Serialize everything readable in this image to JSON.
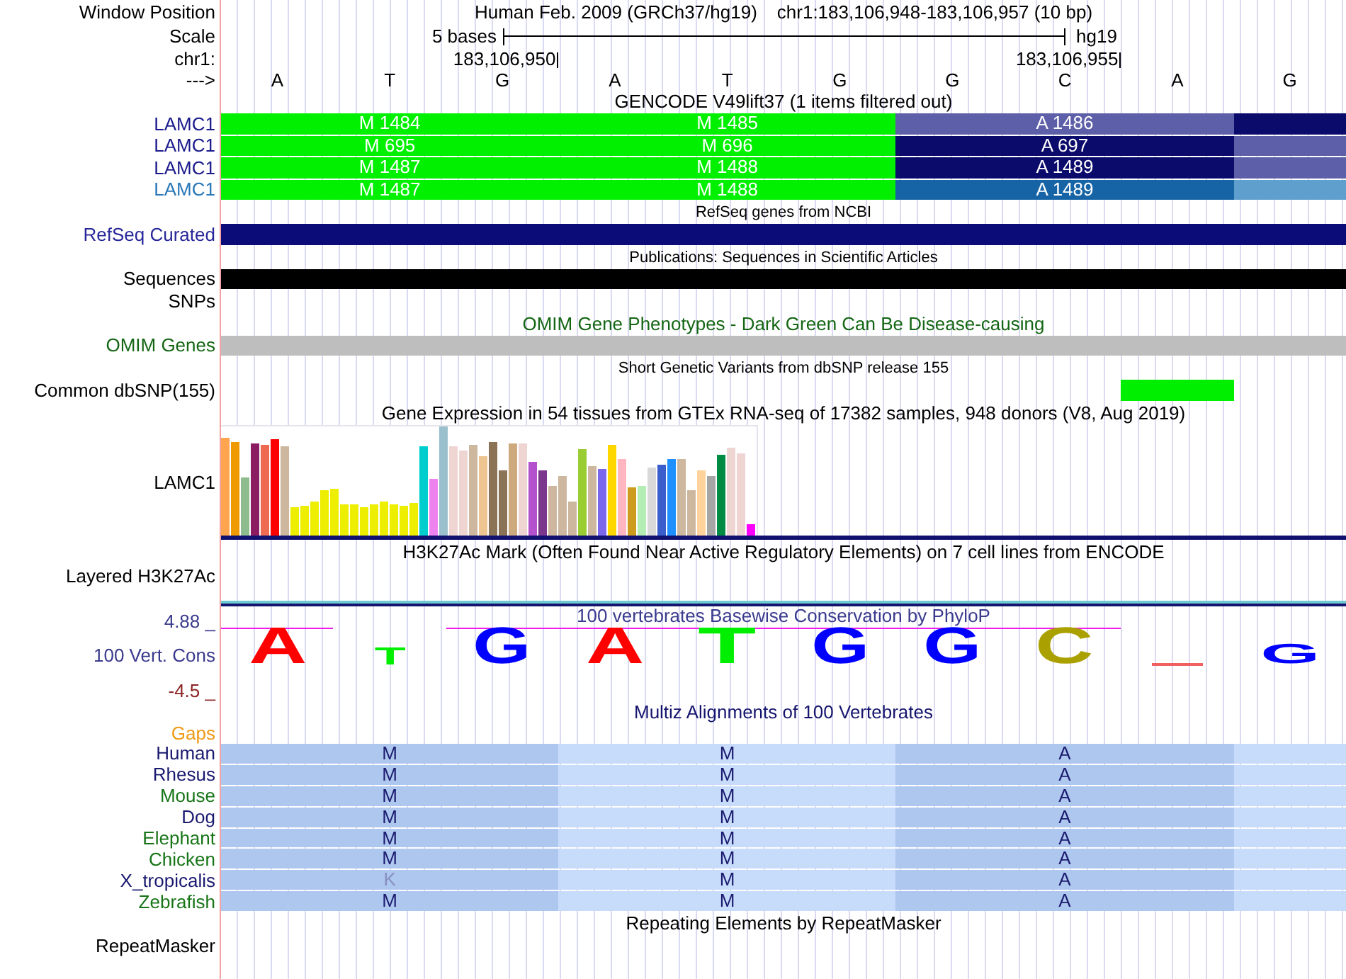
{
  "window_position": {
    "label": "Window Position",
    "assembly": "Human Feb. 2009 (GRCh37/hg19)",
    "range": "chr1:183,106,948-183,106,957 (10 bp)"
  },
  "scale": {
    "label": "Scale",
    "length": "5 bases",
    "assembly": "hg19"
  },
  "ruler": {
    "label": "chr1:",
    "positions": [
      {
        "tick": false
      },
      {
        "tick": false
      },
      {
        "tick": true,
        "label": "183,106,950"
      },
      {
        "tick": false
      },
      {
        "tick": false
      },
      {
        "tick": false
      },
      {
        "tick": false
      },
      {
        "tick": true,
        "label": "183,106,955"
      },
      {
        "tick": false
      },
      {
        "tick": false
      }
    ]
  },
  "sequence": {
    "label": "--->",
    "bases": [
      "A",
      "T",
      "G",
      "A",
      "T",
      "G",
      "G",
      "C",
      "A",
      "G"
    ]
  },
  "tracks": [
    {
      "kind": "features",
      "title": {
        "text": "GENCODE V49lift37 (1 items filtered out)",
        "color": "#000000"
      },
      "rows": [
        {
          "label": "LAMC1",
          "color": "#1b1b8c",
          "segments": [
            {
              "kind": "codon",
              "text": "M 1484",
              "color": "#00f000"
            },
            {
              "kind": "codon",
              "text": "M 1485",
              "color": "#00f000"
            },
            {
              "kind": "codon",
              "text": "A 1486",
              "color": "#5d5fa8"
            },
            {
              "kind": "base",
              "color": "#0b0b6c"
            }
          ]
        },
        {
          "label": "LAMC1",
          "color": "#1b1b8c",
          "segments": [
            {
              "kind": "codon",
              "text": "M 695",
              "color": "#00f000"
            },
            {
              "kind": "codon",
              "text": "M 696",
              "color": "#00f000"
            },
            {
              "kind": "codon",
              "text": "A 697",
              "color": "#0b0b6c"
            },
            {
              "kind": "base",
              "color": "#5d5fa8"
            }
          ]
        },
        {
          "label": "LAMC1",
          "color": "#1b1b8c",
          "segments": [
            {
              "kind": "codon",
              "text": "M 1487",
              "color": "#00f000"
            },
            {
              "kind": "codon",
              "text": "M 1488",
              "color": "#00f000"
            },
            {
              "kind": "codon",
              "text": "A 1489",
              "color": "#0b0b6c"
            },
            {
              "kind": "base",
              "color": "#5d5fa8"
            }
          ]
        },
        {
          "label": "LAMC1",
          "color": "#2a78b8",
          "segments": [
            {
              "kind": "codon",
              "text": "M 1487",
              "color": "#00f000"
            },
            {
              "kind": "codon",
              "text": "M 1488",
              "color": "#00f000"
            },
            {
              "kind": "codon",
              "text": "A 1489",
              "color": "#1664a6"
            },
            {
              "kind": "base",
              "color": "#5f9fcd"
            }
          ]
        }
      ]
    },
    {
      "kind": "features",
      "title": {
        "text": "RefSeq genes from NCBI",
        "color": "#000000"
      },
      "rows": [
        {
          "label": "RefSeq Curated",
          "color": "#27279a",
          "segments": [
            {
              "kind": "full",
              "color": "#0c0c78"
            }
          ]
        }
      ]
    },
    {
      "kind": "features",
      "title": {
        "text": "Publications: Sequences in Scientific Articles",
        "color": "#000000"
      },
      "rows": [
        {
          "label": "Sequences",
          "color": "#000000",
          "segments": [
            {
              "kind": "full",
              "color": "#000000"
            }
          ]
        },
        {
          "label": "SNPs",
          "color": "#000000"
        }
      ]
    },
    {
      "kind": "features",
      "title": {
        "text": "OMIM Gene Phenotypes - Dark Green Can Be Disease-causing",
        "color": "#146614"
      },
      "rows": [
        {
          "label": "OMIM Genes",
          "color": "#146614",
          "segments": [
            {
              "kind": "full",
              "color": "#bebebe"
            }
          ]
        }
      ]
    },
    {
      "kind": "features",
      "title": {
        "text": "Short Genetic Variants from dbSNP release 155",
        "color": "#000000"
      },
      "rows": [
        {
          "label": "Common dbSNP(155)",
          "color": "#000000",
          "segments": [
            {
              "kind": "empty"
            },
            {
              "kind": "empty"
            },
            {
              "kind": "empty"
            },
            {
              "kind": "empty"
            },
            {
              "kind": "empty"
            },
            {
              "kind": "empty"
            },
            {
              "kind": "empty"
            },
            {
              "kind": "empty"
            },
            {
              "kind": "base",
              "color": "#00ee00"
            },
            {
              "kind": "empty"
            }
          ]
        }
      ]
    },
    {
      "kind": "expression",
      "title": {
        "text": "Gene Expression in 54 tissues from GTEx RNA-seq of 17382 samples, 948 donors (V8, Aug 2019)",
        "color": "#000000"
      },
      "rows": [
        {
          "label": "LAMC1",
          "color": "#000000"
        }
      ]
    },
    {
      "kind": "signal",
      "title": {
        "text": "H3K27Ac Mark (Often Found Near Active Regulatory Elements) on 7 cell lines from ENCODE",
        "color": "#000000"
      },
      "rows": [
        {
          "label": "Layered H3K27Ac",
          "color": "#000000"
        }
      ]
    },
    {
      "kind": "conservation",
      "title": {
        "text": "100 vertebrates Basewise Conservation by PhyloP",
        "color": "#3a3a8e"
      },
      "label": {
        "text": "100 Vert. Cons",
        "color": "#3a3a8e"
      },
      "max_label": {
        "text": "4.88 _",
        "color": "#3a3a8e"
      },
      "min_label": {
        "text": "-4.5 _",
        "color": "#8b2323"
      },
      "logo": [
        {
          "kind": "letter",
          "text": "A",
          "color": "#ff0000",
          "clipped": true
        },
        {
          "kind": "letter",
          "text": "T",
          "color": "#00ee00",
          "clipped": false
        },
        {
          "kind": "letter",
          "text": "G",
          "color": "#0000ff",
          "clipped": true
        },
        {
          "kind": "letter",
          "text": "A",
          "color": "#ff0000",
          "clipped": true
        },
        {
          "kind": "letter",
          "text": "T",
          "color": "#00ee00",
          "clipped": true
        },
        {
          "kind": "letter",
          "text": "G",
          "color": "#0000ff",
          "clipped": true
        },
        {
          "kind": "letter",
          "text": "G",
          "color": "#0000ff",
          "clipped": true
        },
        {
          "kind": "letter",
          "text": "C",
          "color": "#aaa000",
          "clipped": true
        },
        {
          "kind": "mark",
          "color": "#f06060",
          "clipped": false
        },
        {
          "kind": "letter",
          "text": "G",
          "color": "#0000ff",
          "clipped": false
        }
      ]
    },
    {
      "kind": "alignment",
      "title": {
        "text": "Multiz Alignments of 100 Vertebrates",
        "color": "#15156e"
      },
      "gaps": {
        "text": "Gaps",
        "color": "#ee9a16"
      },
      "rows": [
        {
          "label": "Human",
          "color": "#191970",
          "cells": [
            {
              "kind": "codon",
              "text": "M",
              "mismatch": false
            },
            {
              "kind": "codon",
              "text": "M",
              "mismatch": false
            },
            {
              "kind": "codon",
              "text": "A",
              "mismatch": false
            },
            {
              "kind": "base"
            }
          ]
        },
        {
          "label": "Rhesus",
          "color": "#191970",
          "cells": [
            {
              "kind": "codon",
              "text": "M",
              "mismatch": false
            },
            {
              "kind": "codon",
              "text": "M",
              "mismatch": false
            },
            {
              "kind": "codon",
              "text": "A",
              "mismatch": false
            },
            {
              "kind": "base"
            }
          ]
        },
        {
          "label": "Mouse",
          "color": "#177517",
          "cells": [
            {
              "kind": "codon",
              "text": "M",
              "mismatch": false
            },
            {
              "kind": "codon",
              "text": "M",
              "mismatch": false
            },
            {
              "kind": "codon",
              "text": "A",
              "mismatch": false
            },
            {
              "kind": "base"
            }
          ]
        },
        {
          "label": "Dog",
          "color": "#191970",
          "cells": [
            {
              "kind": "codon",
              "text": "M",
              "mismatch": false
            },
            {
              "kind": "codon",
              "text": "M",
              "mismatch": false
            },
            {
              "kind": "codon",
              "text": "A",
              "mismatch": false
            },
            {
              "kind": "base"
            }
          ]
        },
        {
          "label": "Elephant",
          "color": "#177517",
          "cells": [
            {
              "kind": "codon",
              "text": "M",
              "mismatch": false
            },
            {
              "kind": "codon",
              "text": "M",
              "mismatch": false
            },
            {
              "kind": "codon",
              "text": "A",
              "mismatch": false
            },
            {
              "kind": "base"
            }
          ]
        },
        {
          "label": "Chicken",
          "color": "#177517",
          "cells": [
            {
              "kind": "codon",
              "text": "M",
              "mismatch": false
            },
            {
              "kind": "codon",
              "text": "M",
              "mismatch": false
            },
            {
              "kind": "codon",
              "text": "A",
              "mismatch": false
            },
            {
              "kind": "base"
            }
          ]
        },
        {
          "label": "X_tropicalis",
          "color": "#191970",
          "cells": [
            {
              "kind": "codon",
              "text": "K",
              "mismatch": true
            },
            {
              "kind": "codon",
              "text": "M",
              "mismatch": false
            },
            {
              "kind": "codon",
              "text": "A",
              "mismatch": false
            },
            {
              "kind": "base"
            }
          ]
        },
        {
          "label": "Zebrafish",
          "color": "#177517",
          "cells": [
            {
              "kind": "codon",
              "text": "M",
              "mismatch": false
            },
            {
              "kind": "codon",
              "text": "M",
              "mismatch": false
            },
            {
              "kind": "codon",
              "text": "A",
              "mismatch": false
            },
            {
              "kind": "base"
            }
          ]
        }
      ]
    },
    {
      "kind": "plain",
      "title": {
        "text": "Repeating Elements by RepeatMasker",
        "color": "#000000"
      },
      "rows": [
        {
          "label": "RepeatMasker",
          "color": "#000000"
        }
      ]
    }
  ]
}
